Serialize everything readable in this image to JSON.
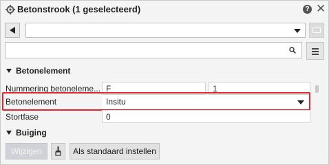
{
  "title": "Betonstrook (1 geselecteerd)",
  "help_glyph": "?",
  "close_glyph": "✕",
  "selector": {
    "value": ""
  },
  "search": {
    "value": "",
    "placeholder": ""
  },
  "section_betonelement": "Betonelement",
  "rows": [
    {
      "label": "Nummering betoneleme...",
      "value1": "F",
      "value2": "1"
    },
    {
      "label": "Betonelement",
      "value": "Insitu"
    },
    {
      "label": "Stortfase",
      "value": "0"
    }
  ],
  "section_buiging": "Buiging",
  "buttons": {
    "modify": "Wijzigen",
    "set_default": "Als standaard instellen"
  },
  "colors": {
    "highlight": "#e3262c",
    "panel_bg": "#f4f4f4"
  },
  "icons": [
    "gear-icon",
    "help-icon",
    "close-icon",
    "back-arrow-icon",
    "dropdown-arrow-icon",
    "image-icon",
    "search-icon",
    "menu-icon",
    "brush-icon"
  ]
}
